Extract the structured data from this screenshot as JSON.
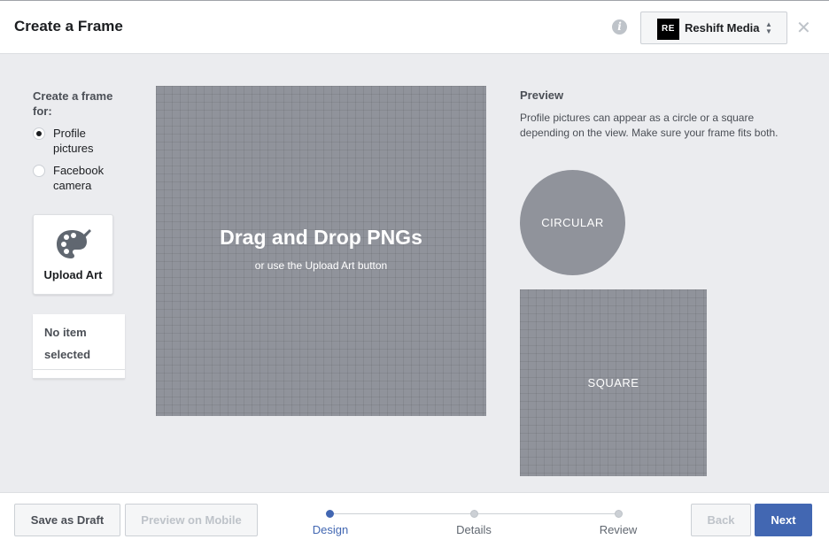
{
  "header": {
    "title": "Create a Frame",
    "info_icon": "info-icon",
    "page_selector": {
      "logo_text": "RE",
      "name": "Reshift Media",
      "caret_icon": "sort-caret-icon"
    },
    "close_icon": "close-icon"
  },
  "left": {
    "create_for_label": "Create a frame for:",
    "options": [
      {
        "label": "Profile pictures",
        "selected": true
      },
      {
        "label": "Facebook camera",
        "selected": false
      }
    ],
    "upload_art": {
      "label": "Upload Art",
      "icon": "palette-icon"
    },
    "no_item": "No item selected"
  },
  "dropzone": {
    "title": "Drag and Drop PNGs",
    "subtitle": "or use the Upload Art button"
  },
  "preview": {
    "title": "Preview",
    "description": "Profile pictures can appear as a circle or a square depending on the view. Make sure your frame fits both.",
    "circular_label": "CIRCULAR",
    "square_label": "SQUARE"
  },
  "footer": {
    "save_draft": "Save as Draft",
    "preview_mobile": "Preview on Mobile",
    "back": "Back",
    "next": "Next",
    "steps": [
      {
        "label": "Design",
        "active": true
      },
      {
        "label": "Details",
        "active": false
      },
      {
        "label": "Review",
        "active": false
      }
    ]
  },
  "colors": {
    "accent": "#4267b2",
    "canvas_gray": "#90939b",
    "panel_bg": "#ebecef"
  }
}
